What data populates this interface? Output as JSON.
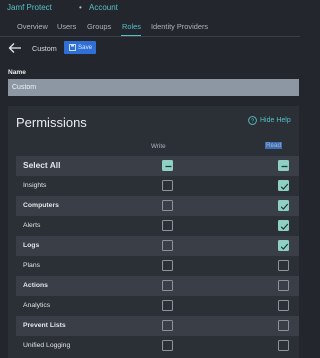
{
  "breadcrumb": {
    "app": "Jamf Protect",
    "separator": "•",
    "page": "Account"
  },
  "tabs": [
    {
      "label": "Overview",
      "active": false
    },
    {
      "label": "Users",
      "active": false
    },
    {
      "label": "Groups",
      "active": false
    },
    {
      "label": "Roles",
      "active": true
    },
    {
      "label": "Identity Providers",
      "active": false
    }
  ],
  "toolbar": {
    "role_name": "Custom",
    "save_label": "Save"
  },
  "form": {
    "name_label": "Name",
    "name_value": "Custom"
  },
  "permissions": {
    "title": "Permissions",
    "hide_help_label": "Hide Help",
    "col_write": "Write",
    "col_read": "Read",
    "rows": [
      {
        "label": "Select All",
        "write": "indeterminate",
        "read": "indeterminate"
      },
      {
        "label": "Insights",
        "write": false,
        "read": true
      },
      {
        "label": "Computers",
        "write": false,
        "read": true
      },
      {
        "label": "Alerts",
        "write": false,
        "read": true
      },
      {
        "label": "Logs",
        "write": false,
        "read": true
      },
      {
        "label": "Plans",
        "write": false,
        "read": false
      },
      {
        "label": "Actions",
        "write": false,
        "read": false
      },
      {
        "label": "Analytics",
        "write": false,
        "read": false
      },
      {
        "label": "Prevent Lists",
        "write": false,
        "read": false
      },
      {
        "label": "Unified Logging",
        "write": false,
        "read": false
      }
    ]
  },
  "colors": {
    "accent": "#56c1c7",
    "save": "#2f6fd6",
    "checked": "#8fd0c3",
    "background": "#23272d"
  }
}
